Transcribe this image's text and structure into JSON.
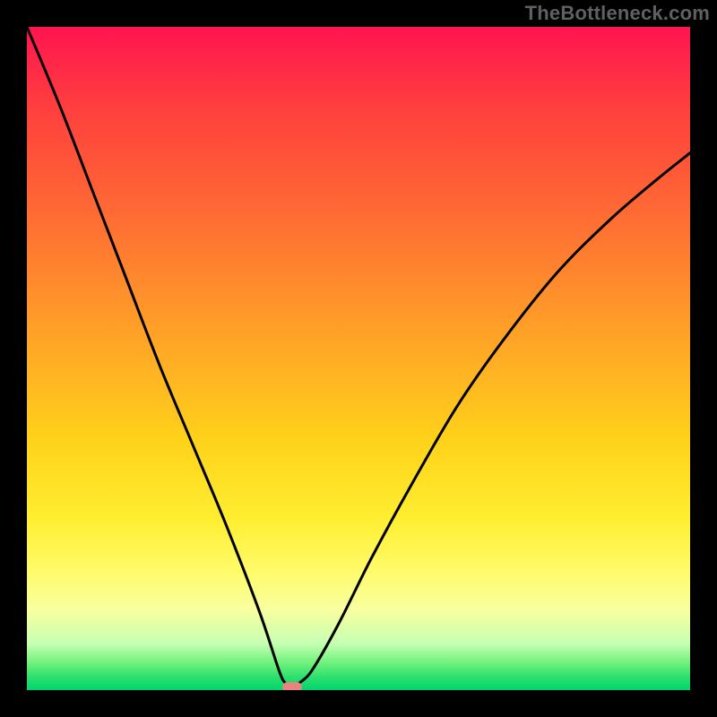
{
  "watermark": "TheBottleneck.com",
  "chart_data": {
    "type": "line",
    "title": "",
    "xlabel": "",
    "ylabel": "",
    "xlim": [
      0,
      100
    ],
    "ylim": [
      0,
      100
    ],
    "grid": false,
    "legend": null,
    "background_gradient": {
      "direction": "vertical",
      "stops": [
        {
          "pos": 0.0,
          "color": "#ff1450"
        },
        {
          "pos": 0.12,
          "color": "#ff3e3e"
        },
        {
          "pos": 0.28,
          "color": "#ff6a34"
        },
        {
          "pos": 0.48,
          "color": "#ffa726"
        },
        {
          "pos": 0.62,
          "color": "#ffd11a"
        },
        {
          "pos": 0.74,
          "color": "#ffee30"
        },
        {
          "pos": 0.82,
          "color": "#fffb6a"
        },
        {
          "pos": 0.88,
          "color": "#f8ffa0"
        },
        {
          "pos": 0.93,
          "color": "#c6ffb3"
        },
        {
          "pos": 0.96,
          "color": "#6df07a"
        },
        {
          "pos": 0.98,
          "color": "#2de070"
        },
        {
          "pos": 1.0,
          "color": "#00d66a"
        }
      ]
    },
    "series": [
      {
        "name": "bottleneck-curve",
        "x": [
          0,
          5,
          10,
          15,
          20,
          25,
          30,
          35,
          38,
          39,
          40,
          41,
          43,
          47,
          52,
          58,
          65,
          72,
          80,
          88,
          95,
          100
        ],
        "y": [
          100,
          88,
          75,
          62,
          49,
          37,
          25,
          12,
          3,
          1,
          0,
          1,
          3,
          10,
          20,
          31,
          43,
          53,
          63,
          71,
          77,
          81
        ]
      }
    ],
    "marker": {
      "x": 40,
      "y": 0,
      "color": "#e6857e"
    }
  },
  "colors": {
    "frame": "#000000",
    "curve": "#000000",
    "watermark": "#606060"
  }
}
